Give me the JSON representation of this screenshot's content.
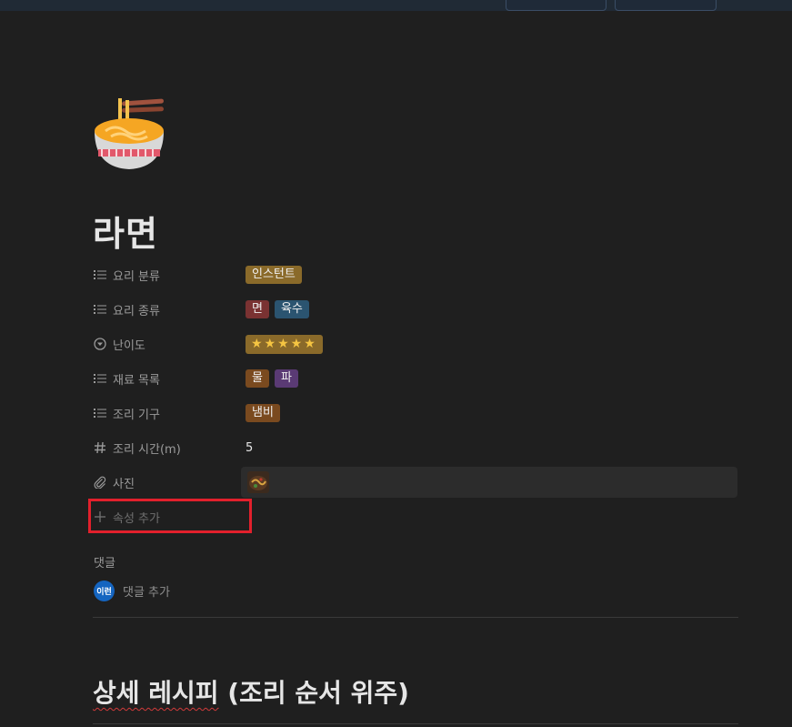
{
  "page": {
    "title": "라면",
    "icon": "ramen-bowl-icon"
  },
  "properties": {
    "category": {
      "label": "요리 분류",
      "icon": "list-icon",
      "tags": [
        "인스턴트"
      ]
    },
    "type": {
      "label": "요리 종류",
      "icon": "list-icon",
      "tags": [
        "면",
        "육수"
      ]
    },
    "difficulty": {
      "label": "난이도",
      "icon": "select-icon",
      "rating": 5,
      "stars": "★★★★★"
    },
    "ingredients": {
      "label": "재료 목록",
      "icon": "list-icon",
      "tags": [
        "물",
        "파"
      ]
    },
    "tools": {
      "label": "조리 기구",
      "icon": "list-icon",
      "tags": [
        "냄비"
      ]
    },
    "cook_time": {
      "label": "조리 시간(m)",
      "icon": "hash-icon",
      "value": "5"
    },
    "photo": {
      "label": "사진",
      "icon": "attachment-icon"
    },
    "add_property": {
      "label": "속성 추가",
      "icon": "plus-icon"
    }
  },
  "comments": {
    "heading": "댓글",
    "avatar_text": "이런",
    "add_label": "댓글 추가"
  },
  "section": {
    "heading_part1": "상세 레시피",
    "heading_part2": " (조리 순서 위주)"
  },
  "colors": {
    "background": "#1f1f1f",
    "highlight": "#e2202c",
    "avatar": "#1565c0"
  }
}
